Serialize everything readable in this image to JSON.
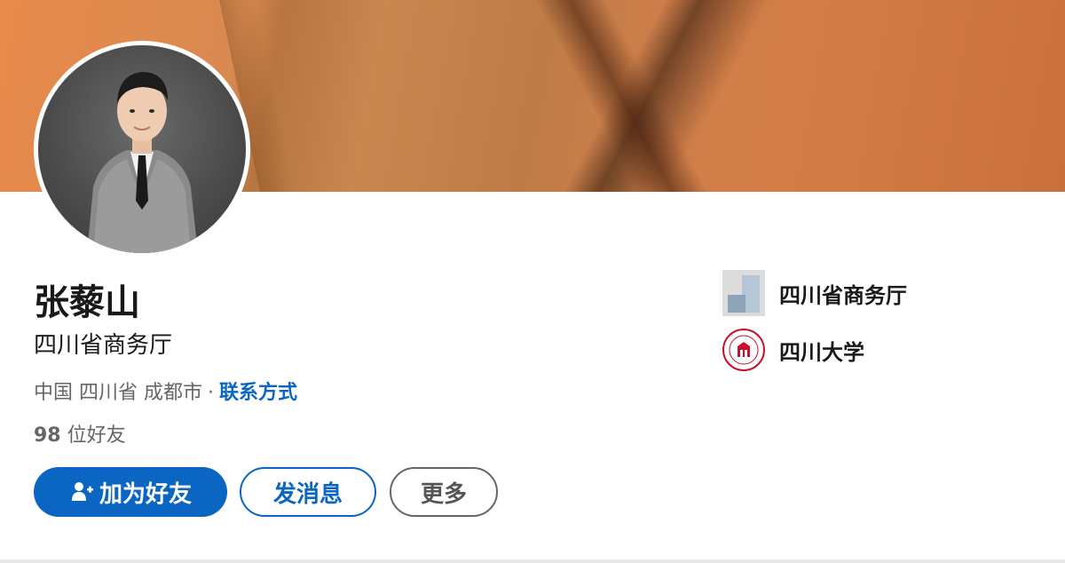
{
  "profile": {
    "name": "张藜山",
    "headline": "四川省商务厅",
    "location": "中国 四川省 成都市",
    "location_separator": "·",
    "contact_link": "联系方式",
    "friends_count": "98",
    "friends_suffix": " 位好友"
  },
  "actions": {
    "add_friend": "加为好友",
    "message": "发消息",
    "more": "更多"
  },
  "orgs": [
    {
      "name": "四川省商务厅",
      "logo": "company-logo-icon"
    },
    {
      "name": "四川大学",
      "logo": "university-seal-icon"
    }
  ],
  "colors": {
    "accent": "#0a66c2",
    "text": "#191919",
    "muted": "#666666",
    "banner": "#d07f4a"
  }
}
